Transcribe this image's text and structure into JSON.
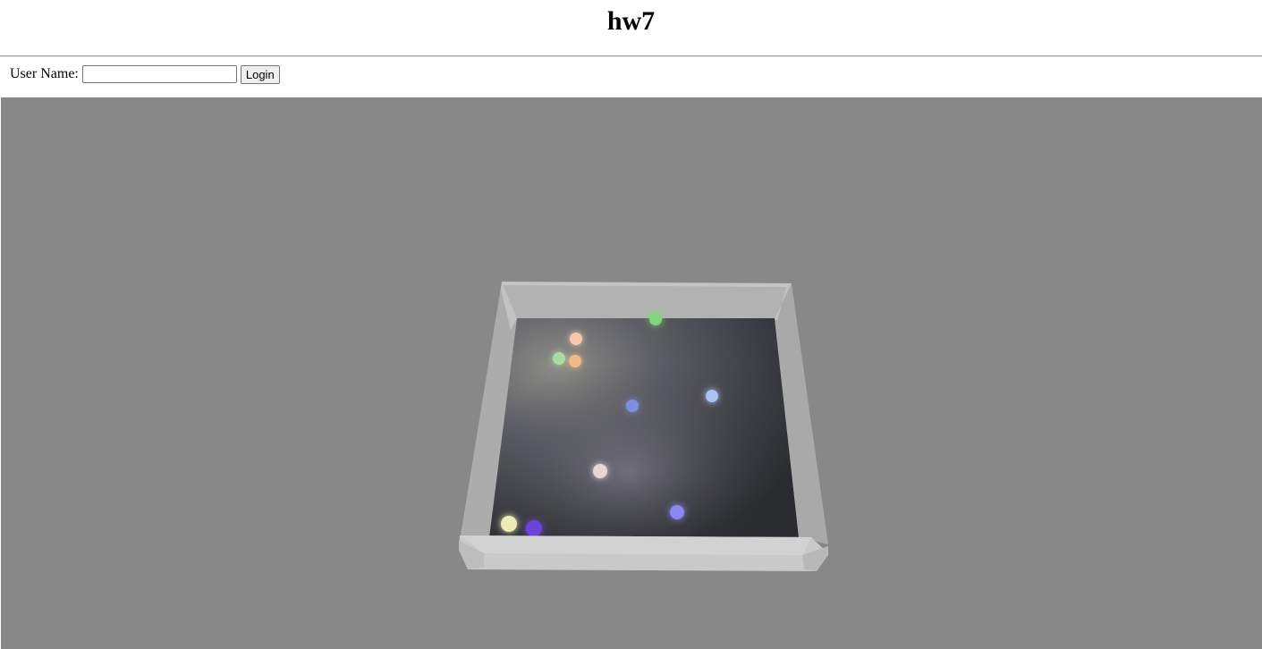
{
  "page": {
    "title": "hw7"
  },
  "login": {
    "label": "User Name:",
    "input_value": "",
    "input_placeholder": "",
    "button_label": "Login"
  },
  "scene": {
    "background_color": "#888888",
    "floor_color": "#2f3134",
    "wall_color": "#c8c8c8",
    "balls": [
      {
        "name": "green-ball-top",
        "color": "#7fd67a"
      },
      {
        "name": "peach-ball",
        "color": "#f4c9ae"
      },
      {
        "name": "light-green-ball",
        "color": "#a8dca2"
      },
      {
        "name": "orange-ball",
        "color": "#f0b987"
      },
      {
        "name": "blue-ball-center",
        "color": "#7b8fe0"
      },
      {
        "name": "light-blue-ball",
        "color": "#a9c1f3"
      },
      {
        "name": "white-ball",
        "color": "#e6d6d8"
      },
      {
        "name": "periwinkle-ball",
        "color": "#8a86f2"
      },
      {
        "name": "yellow-ball",
        "color": "#ececb4"
      },
      {
        "name": "purple-ball",
        "color": "#6c45d8"
      }
    ]
  }
}
